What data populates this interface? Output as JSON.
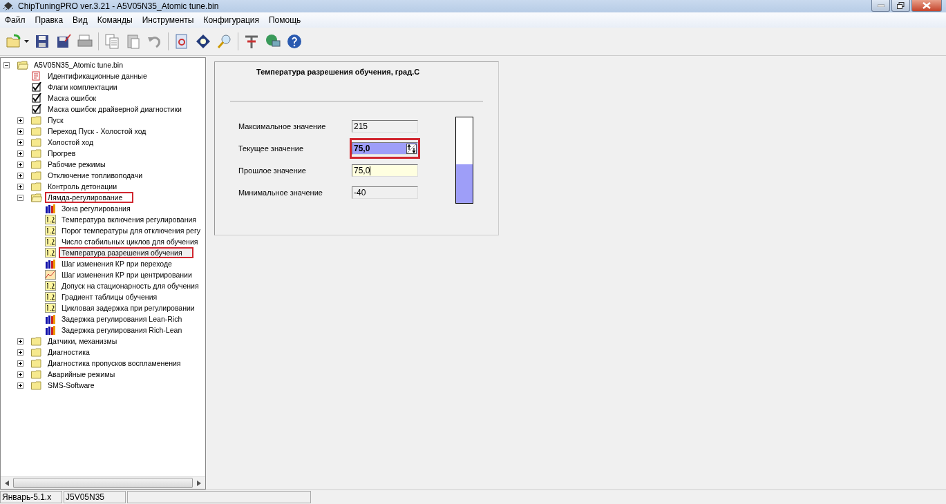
{
  "window": {
    "title": "ChipTuningPRO ver.3.21 - A5V05N35_Atomic tune.bin"
  },
  "menu": [
    "Файл",
    "Правка",
    "Вид",
    "Команды",
    "Инструменты",
    "Конфигурация",
    "Помощь"
  ],
  "tree": [
    {
      "label": "A5V05N35_Atomic tune.bin",
      "kind": "folder",
      "expanded": true,
      "selected": false,
      "highlighted": false,
      "children": [
        {
          "label": "Идентификационные данные",
          "kind": "doc",
          "selected": false,
          "highlighted": false
        },
        {
          "label": "Флаги комплектации",
          "kind": "check",
          "selected": false,
          "highlighted": false
        },
        {
          "label": "Маска ошибок",
          "kind": "check",
          "selected": false,
          "highlighted": false
        },
        {
          "label": "Маска ошибок драйверной диагностики",
          "kind": "check",
          "selected": false,
          "highlighted": false
        },
        {
          "label": "Пуск",
          "kind": "folder",
          "expanded": false,
          "selected": false,
          "highlighted": false
        },
        {
          "label": "Переход Пуск - Холостой ход",
          "kind": "folder",
          "expanded": false,
          "selected": false,
          "highlighted": false
        },
        {
          "label": "Холостой ход",
          "kind": "folder",
          "expanded": false,
          "selected": false,
          "highlighted": false
        },
        {
          "label": "Прогрев",
          "kind": "folder",
          "expanded": false,
          "selected": false,
          "highlighted": false
        },
        {
          "label": "Рабочие режимы",
          "kind": "folder",
          "expanded": false,
          "selected": false,
          "highlighted": false
        },
        {
          "label": "Отключение топливоподачи",
          "kind": "folder",
          "expanded": false,
          "selected": false,
          "highlighted": false
        },
        {
          "label": "Контроль детонации",
          "kind": "folder",
          "expanded": false,
          "selected": false,
          "highlighted": false
        },
        {
          "label": "Лямда-регулирование",
          "kind": "folder",
          "expanded": true,
          "selected": false,
          "highlighted": true,
          "children": [
            {
              "label": "Зона регулирования",
              "kind": "bars",
              "selected": false,
              "highlighted": false
            },
            {
              "label": "Температура включения регулирования",
              "kind": "number",
              "selected": false,
              "highlighted": false
            },
            {
              "label": "Порог температуры для отключения регу",
              "kind": "number",
              "selected": false,
              "highlighted": false
            },
            {
              "label": "Число стабильных циклов для обучения",
              "kind": "number",
              "selected": false,
              "highlighted": false
            },
            {
              "label": "Температура разрешения обучения",
              "kind": "number",
              "selected": true,
              "highlighted": true
            },
            {
              "label": "Шаг изменения КР при переходе",
              "kind": "bars",
              "selected": false,
              "highlighted": false
            },
            {
              "label": "Шаг изменения КР при центрировании",
              "kind": "graph",
              "selected": false,
              "highlighted": false
            },
            {
              "label": "Допуск на стационарность для обучения",
              "kind": "number",
              "selected": false,
              "highlighted": false
            },
            {
              "label": "Градиент таблицы обучения",
              "kind": "number",
              "selected": false,
              "highlighted": false
            },
            {
              "label": "Цикловая задержка при регулировании",
              "kind": "number",
              "selected": false,
              "highlighted": false
            },
            {
              "label": "Задержка регулирования Lean-Rich",
              "kind": "bars",
              "selected": false,
              "highlighted": false
            },
            {
              "label": "Задержка регулирования Rich-Lean",
              "kind": "bars",
              "selected": false,
              "highlighted": false
            }
          ]
        },
        {
          "label": "Датчики, механизмы",
          "kind": "folder",
          "expanded": false,
          "selected": false,
          "highlighted": false
        },
        {
          "label": "Диагностика",
          "kind": "folder",
          "expanded": false,
          "selected": false,
          "highlighted": false
        },
        {
          "label": "Диагностика пропусков воспламенения",
          "kind": "folder",
          "expanded": false,
          "selected": false,
          "highlighted": false
        },
        {
          "label": "Аварийные режимы",
          "kind": "folder",
          "expanded": false,
          "selected": false,
          "highlighted": false
        },
        {
          "label": "SMS-Software",
          "kind": "folder",
          "expanded": false,
          "selected": false,
          "highlighted": false
        }
      ]
    }
  ],
  "panel": {
    "title": "Температура разрешения обучения, град.С",
    "fields": [
      {
        "label": "Максимальное значение",
        "value": "215",
        "kind": "readonly",
        "highlighted": false
      },
      {
        "label": "Текущее значение",
        "value": "75,0",
        "kind": "spin",
        "highlighted": true
      },
      {
        "label": "Прошлое значение",
        "value": "75,0",
        "kind": "edit",
        "highlighted": false
      },
      {
        "label": "Минимальное значение",
        "value": "-40",
        "kind": "readonly",
        "highlighted": false
      }
    ],
    "gauge": {
      "level": 0.45
    }
  },
  "status_bar": [
    "Январь-5.1.x",
    "J5V05N35"
  ]
}
